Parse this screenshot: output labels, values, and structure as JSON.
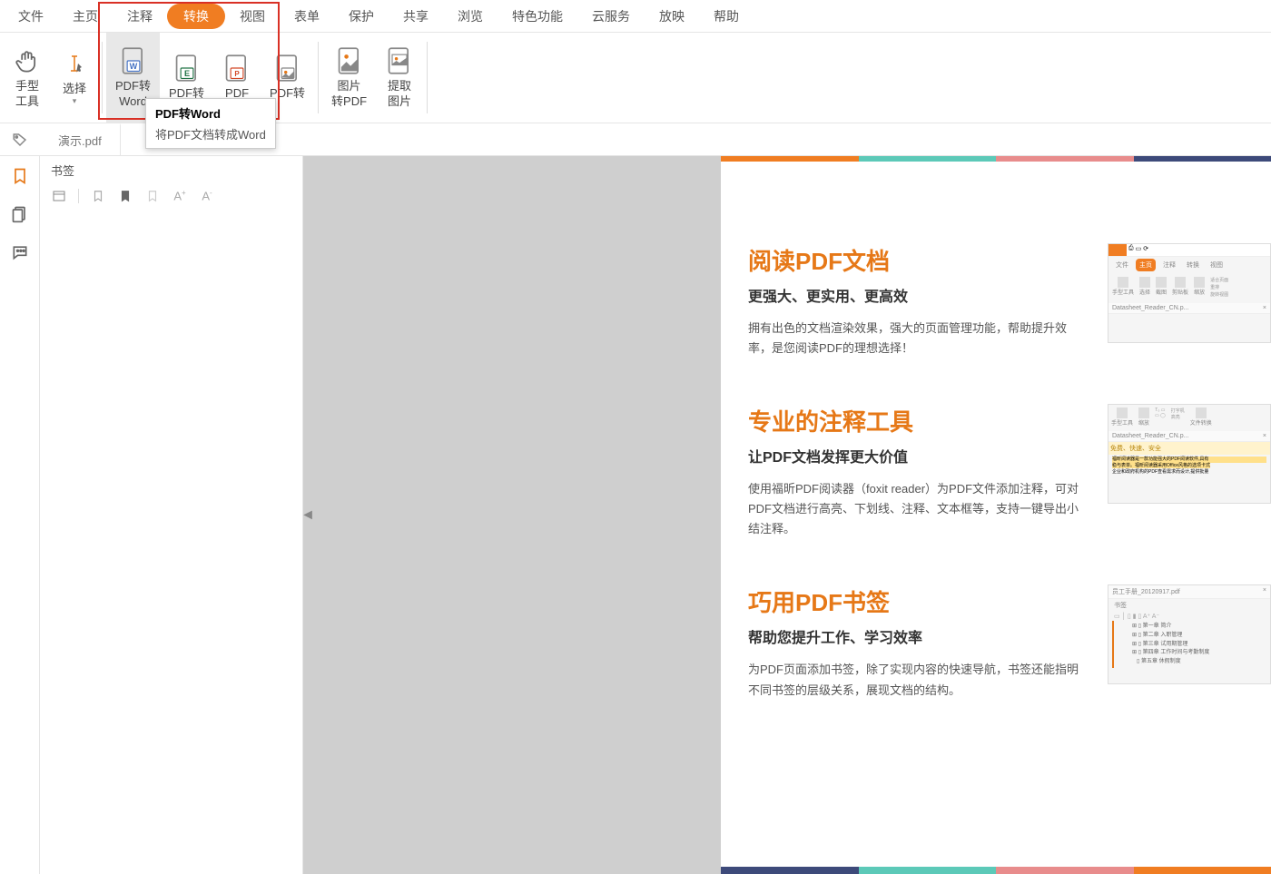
{
  "menu": {
    "items": [
      "文件",
      "主页",
      "注释",
      "转换",
      "视图",
      "表单",
      "保护",
      "共享",
      "浏览",
      "特色功能",
      "云服务",
      "放映",
      "帮助"
    ],
    "active_index": 3
  },
  "ribbon": {
    "hand_tool": "手型\n工具",
    "select": "选择",
    "pdf_to_word": "PDF转\nWord",
    "pdf_to_excel": "PDF转",
    "pdf_generic": "PDF",
    "pdf_to_ppt": "PDF转",
    "img_to_pdf": "图片\n转PDF",
    "extract_img": "提取\n图片"
  },
  "tooltip": {
    "title": "PDF转Word",
    "desc": "将PDF文档转成Word"
  },
  "tab": {
    "filename": "演示.pdf"
  },
  "bookmark": {
    "title": "书签"
  },
  "features": [
    {
      "title": "阅读PDF文档",
      "sub": "更强大、更实用、更高效",
      "desc": "拥有出色的文档渲染效果，强大的页面管理功能，帮助提升效率，是您阅读PDF的理想选择！",
      "mini_file": "Datasheet_Reader_CN.p...",
      "mini_tabs": [
        "文件",
        "主页",
        "注释",
        "转换",
        "视图"
      ],
      "mini_labels": [
        "手型工具",
        "选择",
        "截图",
        "剪贴板",
        "缩放"
      ],
      "mini_side": [
        "适合页面",
        "重排",
        "旋转视图"
      ]
    },
    {
      "title": "专业的注释工具",
      "sub": "让PDF文档发挥更大价值",
      "desc": "使用福昕PDF阅读器（foxit reader）为PDF文件添加注释，可对PDF文档进行高亮、下划线、注释、文本框等，支持一键导出小结注释。",
      "mini_file": "Datasheet_Reader_CN.p...",
      "mini_hl": "免费、快速、安全",
      "mini_labels": [
        "手型工具",
        "缩放",
        "打字机",
        "高亮",
        "文件转换"
      ],
      "mini_body_lines": [
        "福昕阅读器是一款功能强大的PDF阅读软件,具有",
        "稳与表单。福昕阅读器采用Office风格的选项卡式",
        "企业和政府机构的PDF查看需求而设计,提供批量"
      ]
    },
    {
      "title": "巧用PDF书签",
      "sub": "帮助您提升工作、学习效率",
      "desc": "为PDF页面添加书签，除了实现内容的快速导航，书签还能指明不同书签的层级关系，展现文档的结构。",
      "mini_file": "员工手册_20120917.pdf",
      "mini_bm_title": "书签",
      "mini_bm_items": [
        "第一章  简介",
        "第二章  入职管理",
        "第三章  试用期管理",
        "第四章  工作时间与考勤制度",
        "第五章  休假制度"
      ]
    }
  ]
}
